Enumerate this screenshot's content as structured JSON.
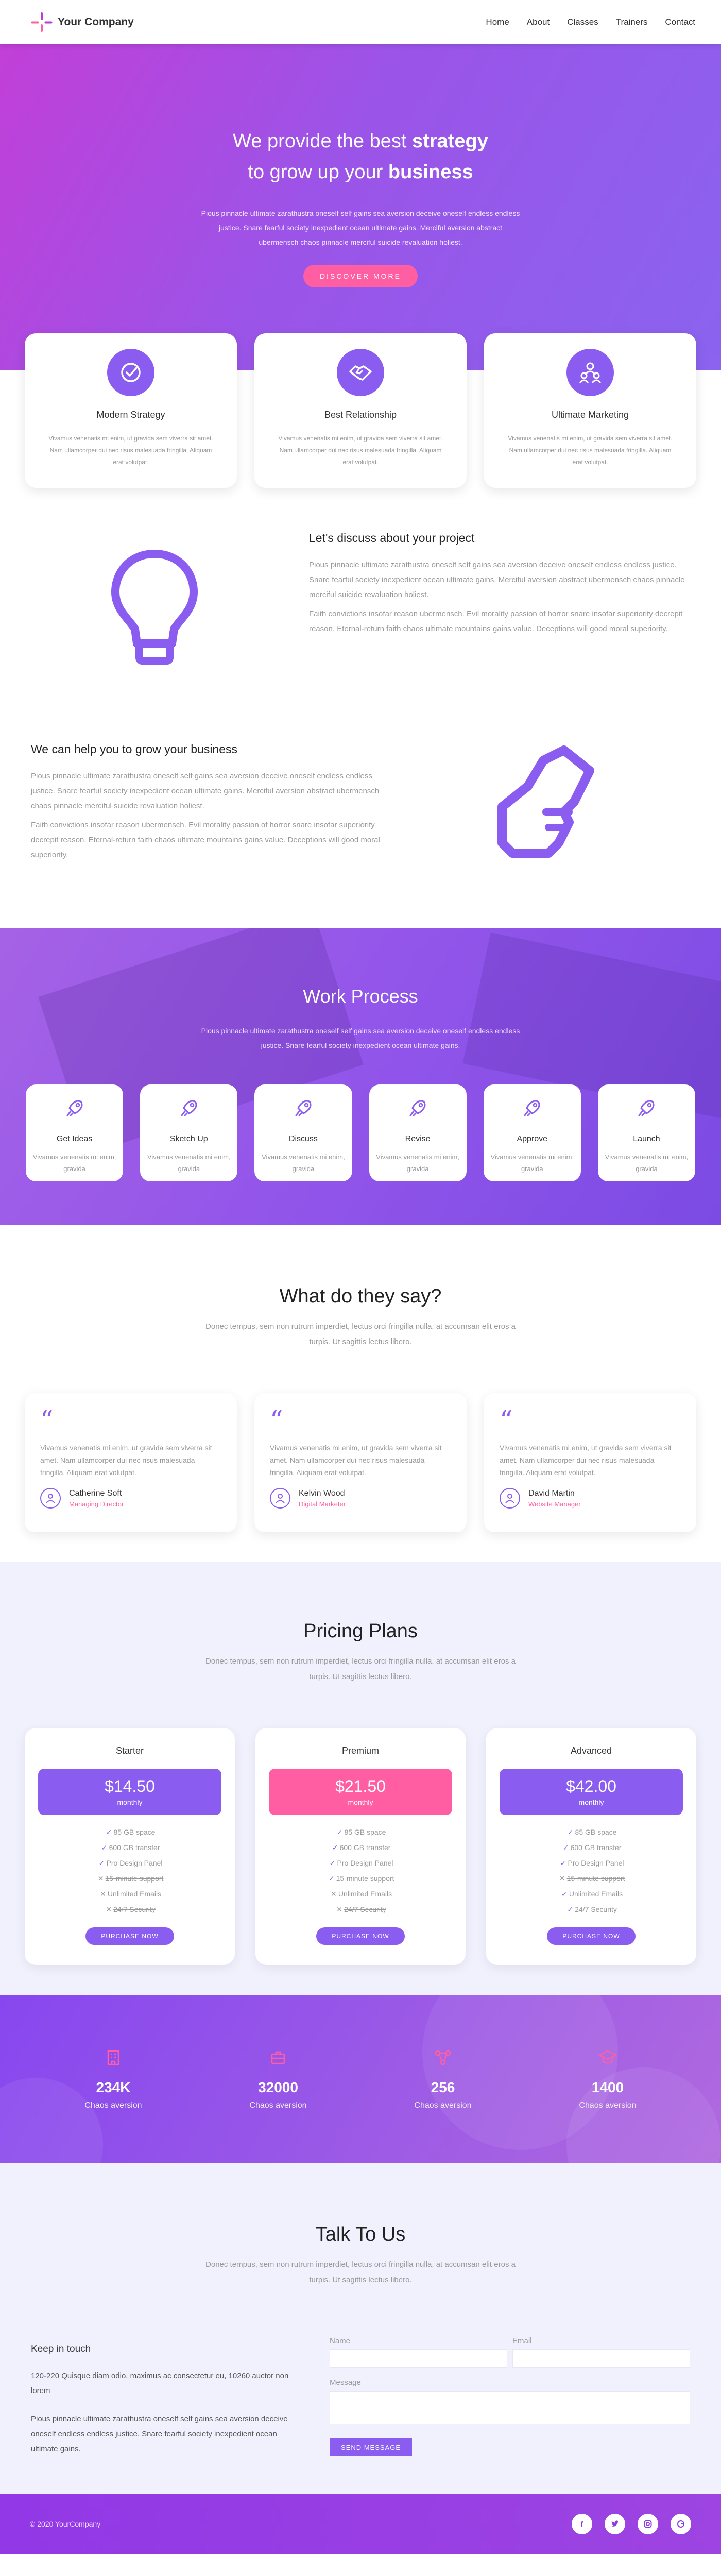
{
  "nav": {
    "brand": "Your Company",
    "links": [
      "Home",
      "About",
      "Classes",
      "Trainers",
      "Contact"
    ]
  },
  "hero": {
    "title_line1_pre": "We provide the best ",
    "title_line1_strong": "strategy",
    "title_line2_pre": "to grow up your ",
    "title_line2_strong": "business",
    "text": "Pious pinnacle ultimate zarathustra oneself self gains sea aversion deceive oneself endless endless justice. Snare fearful society inexpedient ocean ultimate gains. Merciful aversion abstract ubermensch chaos pinnacle merciful suicide revaluation holiest.",
    "button": "DISCOVER MORE"
  },
  "features": [
    {
      "icon": "check-badge-icon",
      "title": "Modern Strategy",
      "text": "Vivamus venenatis mi enim, ut gravida sem viverra sit amet. Nam ullamcorper dui nec risus malesuada fringilla. Aliquam erat volutpat."
    },
    {
      "icon": "handshake-icon",
      "title": "Best Relationship",
      "text": "Vivamus venenatis mi enim, ut gravida sem viverra sit amet. Nam ullamcorper dui nec risus malesuada fringilla. Aliquam erat volutpat."
    },
    {
      "icon": "team-icon",
      "title": "Ultimate Marketing",
      "text": "Vivamus venenatis mi enim, ut gravida sem viverra sit amet. Nam ullamcorper dui nec risus malesuada fringilla. Aliquam erat volutpat."
    }
  ],
  "about1": {
    "title": "Let's discuss about your project",
    "p1": "Pious pinnacle ultimate zarathustra oneself self gains sea aversion deceive oneself endless endless justice. Snare fearful society inexpedient ocean ultimate gains. Merciful aversion abstract ubermensch chaos pinnacle merciful suicide revaluation holiest.",
    "p2": "Faith convictions insofar reason ubermensch. Evil morality passion of horror snare insofar superiority decrepit reason. Eternal-return faith chaos ultimate mountains gains value. Deceptions will good moral superiority."
  },
  "about2": {
    "title": "We can help you to grow your business",
    "p1": "Pious pinnacle ultimate zarathustra oneself self gains sea aversion deceive oneself endless endless justice. Snare fearful society inexpedient ocean ultimate gains. Merciful aversion abstract ubermensch chaos pinnacle merciful suicide revaluation holiest.",
    "p2": "Faith convictions insofar reason ubermensch. Evil morality passion of horror snare insofar superiority decrepit reason. Eternal-return faith chaos ultimate mountains gains value. Deceptions will good moral superiority."
  },
  "process": {
    "title": "Work Process",
    "text": "Pious pinnacle ultimate zarathustra oneself self gains sea aversion deceive oneself endless endless justice. Snare fearful society inexpedient ocean ultimate gains.",
    "steps": [
      {
        "title": "Get Ideas",
        "text": "Vivamus venenatis mi enim, gravida"
      },
      {
        "title": "Sketch Up",
        "text": "Vivamus venenatis mi enim, gravida"
      },
      {
        "title": "Discuss",
        "text": "Vivamus venenatis mi enim, gravida"
      },
      {
        "title": "Revise",
        "text": "Vivamus venenatis mi enim, gravida"
      },
      {
        "title": "Approve",
        "text": "Vivamus venenatis mi enim, gravida"
      },
      {
        "title": "Launch",
        "text": "Vivamus venenatis mi enim, gravida"
      }
    ]
  },
  "testimonials": {
    "title": "What do they say?",
    "subtitle": "Donec tempus, sem non rutrum imperdiet, lectus orci fringilla nulla, at accumsan elit eros a turpis. Ut sagittis lectus libero.",
    "items": [
      {
        "text": "Vivamus venenatis mi enim, ut gravida sem viverra sit amet. Nam ullamcorper dui nec risus malesuada fringilla. Aliquam erat volutpat.",
        "name": "Catherine Soft",
        "role": "Managing Director"
      },
      {
        "text": "Vivamus venenatis mi enim, ut gravida sem viverra sit amet. Nam ullamcorper dui nec risus malesuada fringilla. Aliquam erat volutpat.",
        "name": "Kelvin Wood",
        "role": "Digital Marketer"
      },
      {
        "text": "Vivamus venenatis mi enim, ut gravida sem viverra sit amet. Nam ullamcorper dui nec risus malesuada fringilla. Aliquam erat volutpat.",
        "name": "David Martin",
        "role": "Website Manager"
      }
    ]
  },
  "pricing": {
    "title": "Pricing Plans",
    "subtitle": "Donec tempus, sem non rutrum imperdiet, lectus orci fringilla nulla, at accumsan elit eros a turpis. Ut sagittis lectus libero.",
    "button": "PURCHASE NOW",
    "plans": [
      {
        "name": "Starter",
        "price": "$14.50",
        "per": "monthly",
        "color": "#8a5cf0",
        "features": [
          {
            "t": "85 GB space",
            "on": true
          },
          {
            "t": "600 GB transfer",
            "on": true
          },
          {
            "t": "Pro Design Panel",
            "on": true
          },
          {
            "t": "15-minute support",
            "on": false
          },
          {
            "t": "Unlimited Emails",
            "on": false
          },
          {
            "t": "24/7 Security",
            "on": false
          }
        ]
      },
      {
        "name": "Premium",
        "price": "$21.50",
        "per": "monthly",
        "color": "#ff5fa2",
        "features": [
          {
            "t": "85 GB space",
            "on": true
          },
          {
            "t": "600 GB transfer",
            "on": true
          },
          {
            "t": "Pro Design Panel",
            "on": true
          },
          {
            "t": "15-minute support",
            "on": true
          },
          {
            "t": "Unlimited Emails",
            "on": false
          },
          {
            "t": "24/7 Security",
            "on": false
          }
        ]
      },
      {
        "name": "Advanced",
        "price": "$42.00",
        "per": "monthly",
        "color": "#8a5cf0",
        "features": [
          {
            "t": "85 GB space",
            "on": true
          },
          {
            "t": "600 GB transfer",
            "on": true
          },
          {
            "t": "Pro Design Panel",
            "on": true
          },
          {
            "t": "15-minute support",
            "on": false
          },
          {
            "t": "Unlimited Emails",
            "on": true
          },
          {
            "t": "24/7 Security",
            "on": true
          }
        ]
      }
    ]
  },
  "stats": [
    {
      "icon": "building-icon",
      "value": "234K",
      "label": "Chaos aversion"
    },
    {
      "icon": "briefcase-icon",
      "value": "32000",
      "label": "Chaos aversion"
    },
    {
      "icon": "network-icon",
      "value": "256",
      "label": "Chaos aversion"
    },
    {
      "icon": "graduation-cap-icon",
      "value": "1400",
      "label": "Chaos aversion"
    }
  ],
  "contact": {
    "title": "Talk To Us",
    "subtitle": "Donec tempus, sem non rutrum imperdiet, lectus orci fringilla nulla, at accumsan elit eros a turpis. Ut sagittis lectus libero.",
    "keep_title": "Keep in touch",
    "address": "120-220 Quisque diam odio, maximus ac consectetur eu, 10260 auctor non lorem",
    "text": "Pious pinnacle ultimate zarathustra oneself self gains sea aversion deceive oneself endless endless justice. Snare fearful society inexpedient ocean ultimate gains.",
    "name_label": "Name",
    "email_label": "Email",
    "message_label": "Message",
    "send": "SEND MESSAGE"
  },
  "footer": {
    "copyright": "© 2020 YourCompany",
    "socials": [
      "facebook-icon",
      "twitter-icon",
      "instagram-icon",
      "google-icon"
    ]
  },
  "colors": {
    "primary": "#8a5cf0",
    "accent": "#ff5fa2",
    "pale": "#f1f0fd"
  }
}
